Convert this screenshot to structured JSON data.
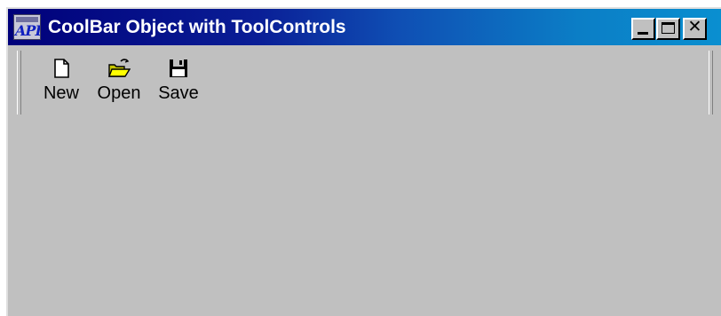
{
  "window": {
    "title": "CoolBar Object with ToolControls",
    "app_icon_glyph": "API",
    "caption_buttons": {
      "minimize_icon": "minimize-icon",
      "maximize_icon": "maximize-icon",
      "close_icon": "close-icon",
      "close_glyph": "✕"
    }
  },
  "coolbar": {
    "buttons": [
      {
        "label": "New",
        "icon": "new-document-icon"
      },
      {
        "label": "Open",
        "icon": "open-folder-icon"
      },
      {
        "label": "Save",
        "icon": "save-floppy-icon"
      }
    ]
  },
  "colors": {
    "titlebar_start": "#00007a",
    "titlebar_end": "#0a8fd0",
    "window_face": "#c0c0c0",
    "folder_yellow": "#ffff00",
    "floppy_dark": "#000000"
  }
}
